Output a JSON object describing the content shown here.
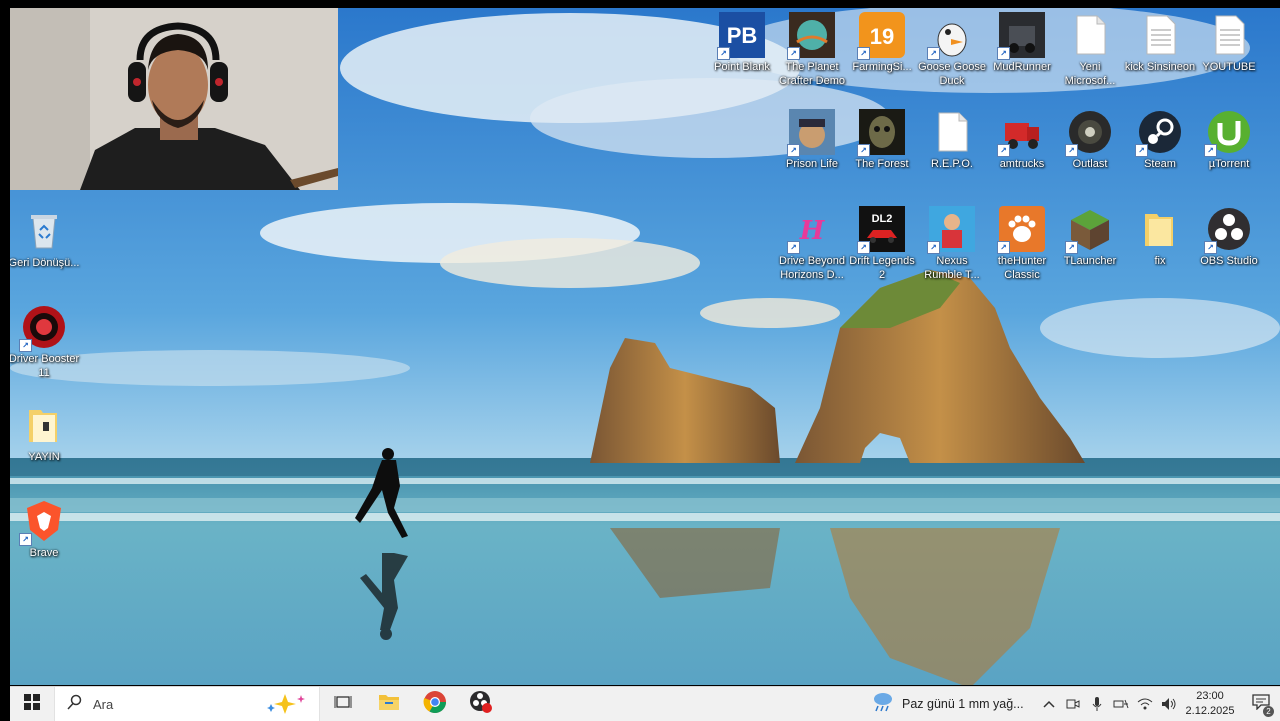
{
  "desktop": {
    "left_icons": [
      {
        "label": "Geri Dönüşü...",
        "icon": "recycle-bin-icon"
      },
      {
        "label": "Driver Booster 11",
        "icon": "driver-booster-icon"
      },
      {
        "label": "YAYIN",
        "icon": "folder-icon"
      },
      {
        "label": "Brave",
        "icon": "brave-icon"
      }
    ],
    "row1": [
      {
        "label": "Point Blank",
        "icon": "point-blank-icon"
      },
      {
        "label": "The Planet Crafter Demo",
        "icon": "planet-crafter-icon"
      },
      {
        "label": "FarmingSi...",
        "icon": "farming-simulator-icon"
      },
      {
        "label": "Goose Goose Duck",
        "icon": "goose-goose-duck-icon"
      },
      {
        "label": "MudRunner",
        "icon": "mudrunner-icon"
      },
      {
        "label": "Yeni Microsof...",
        "icon": "document-icon"
      },
      {
        "label": "kick Sinsineon",
        "icon": "text-file-icon"
      },
      {
        "label": "YOUTUBE",
        "icon": "text-file-icon"
      }
    ],
    "row2": [
      {
        "label": "Prison Life",
        "icon": "prison-life-icon"
      },
      {
        "label": "The Forest",
        "icon": "the-forest-icon"
      },
      {
        "label": "R.E.P.O.",
        "icon": "document-icon"
      },
      {
        "label": "amtrucks",
        "icon": "american-truck-icon"
      },
      {
        "label": "Outlast",
        "icon": "outlast-icon"
      },
      {
        "label": "Steam",
        "icon": "steam-icon"
      },
      {
        "label": "µTorrent",
        "icon": "utorrent-icon"
      }
    ],
    "row3": [
      {
        "label": "Drive Beyond Horizons D...",
        "icon": "drive-beyond-horizons-icon"
      },
      {
        "label": "Drift Legends 2",
        "icon": "drift-legends-icon"
      },
      {
        "label": "Nexus Rumble T...",
        "icon": "nexus-rumble-icon"
      },
      {
        "label": "theHunter Classic",
        "icon": "thehunter-icon"
      },
      {
        "label": "TLauncher",
        "icon": "tlauncher-icon"
      },
      {
        "label": "fix",
        "icon": "folder-icon"
      },
      {
        "label": "OBS Studio",
        "icon": "obs-studio-icon"
      }
    ]
  },
  "taskbar": {
    "search_placeholder": "Ara",
    "weather_text": "Paz günü 1 mm yağ...",
    "time": "23:00",
    "date": "2.12.2025",
    "notification_count": "2"
  },
  "colors": {
    "taskbar_bg": "#f1f1f1",
    "sky_top": "#2f7fd0",
    "sea": "#5aa0b5"
  }
}
